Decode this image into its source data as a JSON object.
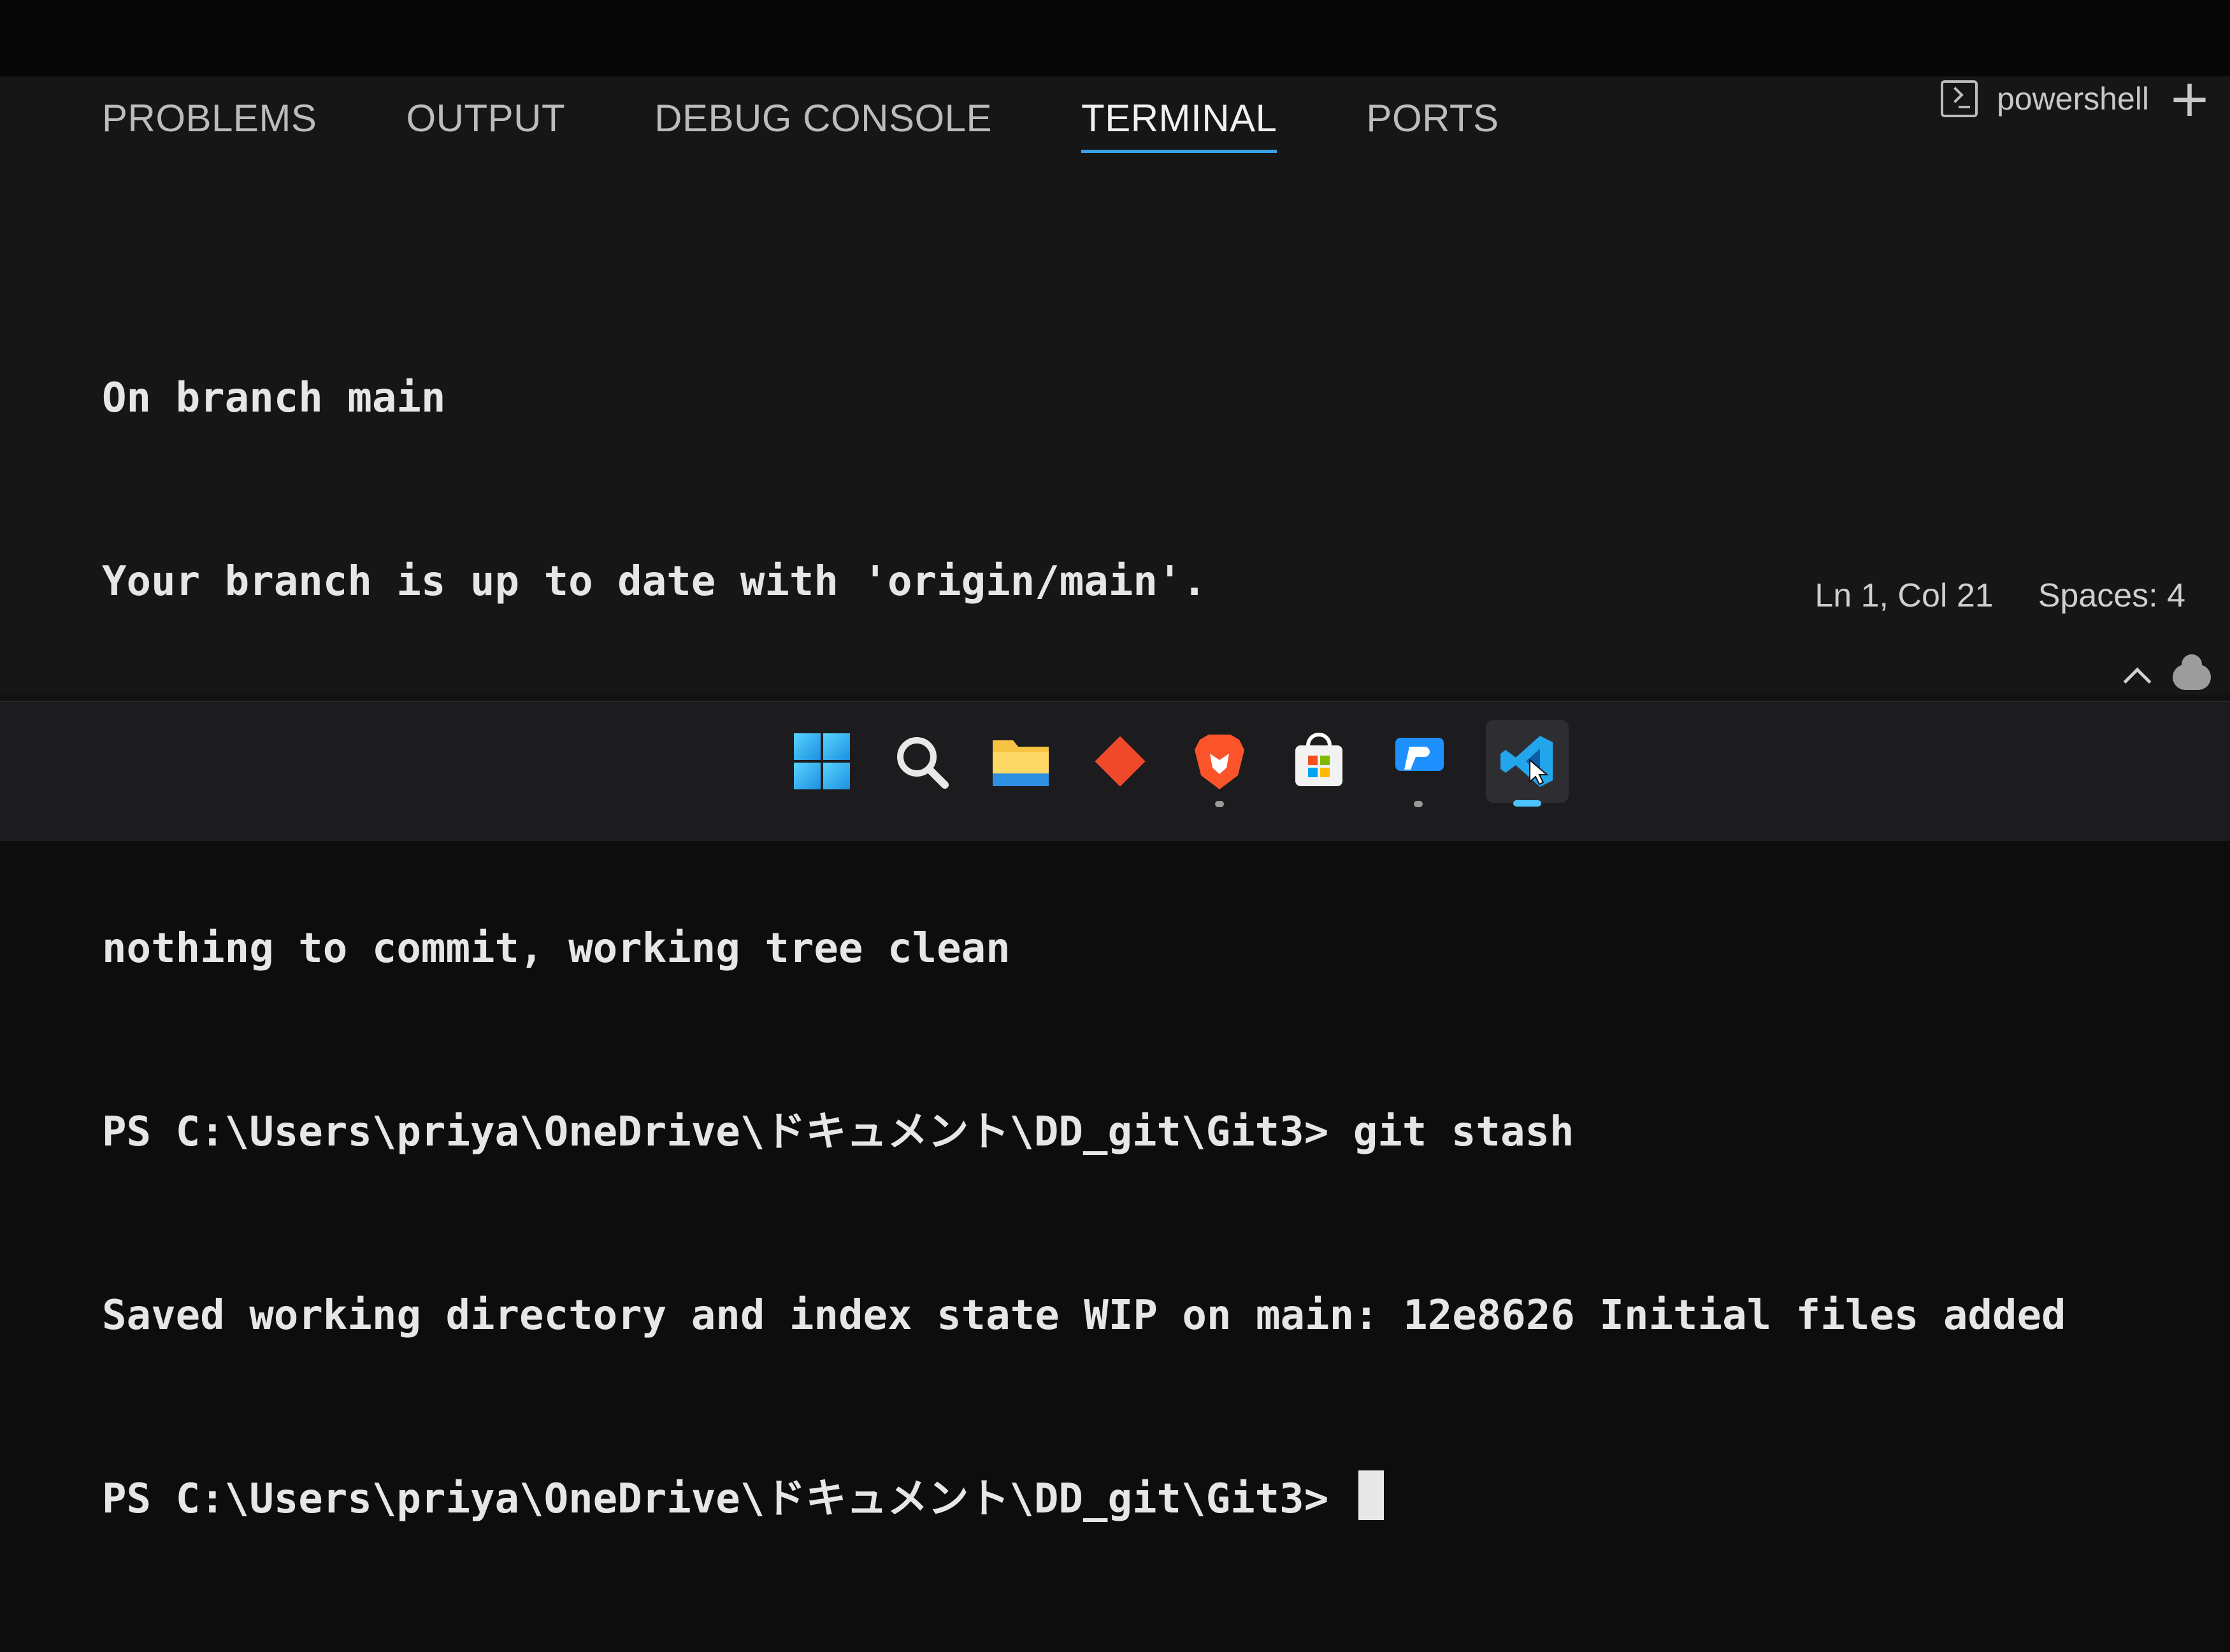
{
  "panel": {
    "tabs": [
      {
        "label": "PROBLEMS"
      },
      {
        "label": "OUTPUT"
      },
      {
        "label": "DEBUG CONSOLE"
      },
      {
        "label": "TERMINAL"
      },
      {
        "label": "PORTS"
      }
    ],
    "active_tab": "TERMINAL",
    "shell_label": "powershell",
    "add_label": "+"
  },
  "terminal": {
    "lines": [
      "On branch main",
      "Your branch is up to date with 'origin/main'.",
      "",
      "nothing to commit, working tree clean",
      "PS C:\\Users\\priya\\OneDrive\\ドキュメント\\DD_git\\Git3> git stash",
      "Saved working directory and index state WIP on main: 12e8626 Initial files added",
      "PS C:\\Users\\priya\\OneDrive\\ドキュメント\\DD_git\\Git3> "
    ]
  },
  "status": {
    "position": "Ln 1, Col 21",
    "indent": "Spaces: 4"
  },
  "taskbar": {
    "icons": [
      "windows-start-icon",
      "search-icon",
      "file-explorer-icon",
      "git-app-icon",
      "brave-browser-icon",
      "microsoft-store-icon",
      "remote-desktop-icon",
      "vscode-icon"
    ]
  },
  "colors": {
    "background": "#121213",
    "active_tab_underline": "#3aa0e8",
    "terminal_text": "#e6e6e6"
  }
}
